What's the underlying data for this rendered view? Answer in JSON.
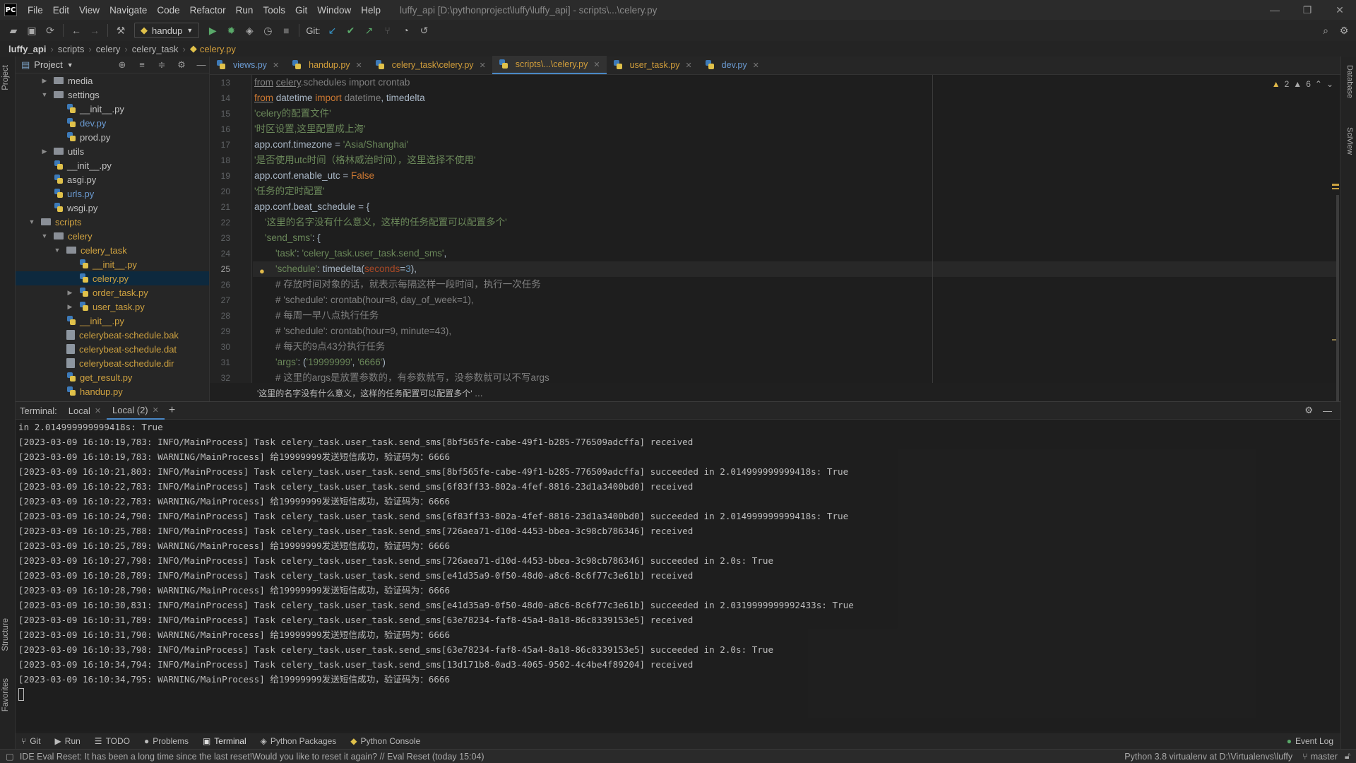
{
  "menubar": {
    "logo": "PC",
    "items": [
      "File",
      "Edit",
      "View",
      "Navigate",
      "Code",
      "Refactor",
      "Run",
      "Tools",
      "Git",
      "Window",
      "Help"
    ],
    "window_title": "luffy_api [D:\\pythonproject\\luffy\\luffy_api] - scripts\\...\\celery.py"
  },
  "toolbar": {
    "run_config": "handup",
    "git_label": "Git:"
  },
  "breadcrumb": [
    "luffy_api",
    "scripts",
    "celery",
    "celery_task",
    "celery.py"
  ],
  "left_strip": {
    "project": "Project",
    "structure": "Structure",
    "favorites": "Favorites"
  },
  "right_strip": {
    "database": "Database",
    "sciview": "SciView"
  },
  "project_panel": {
    "title": "Project",
    "tree": [
      {
        "label": "media",
        "type": "folder",
        "indent": 2,
        "arrow": "▶",
        "color": "plain"
      },
      {
        "label": "settings",
        "type": "folder",
        "indent": 2,
        "arrow": "▼",
        "color": "plain"
      },
      {
        "label": "__init__.py",
        "type": "py",
        "indent": 3,
        "color": "plain"
      },
      {
        "label": "dev.py",
        "type": "py",
        "indent": 3,
        "color": "blue"
      },
      {
        "label": "prod.py",
        "type": "py",
        "indent": 3,
        "color": "plain"
      },
      {
        "label": "utils",
        "type": "folder",
        "indent": 2,
        "arrow": "▶",
        "color": "plain"
      },
      {
        "label": "__init__.py",
        "type": "py",
        "indent": 2,
        "color": "plain"
      },
      {
        "label": "asgi.py",
        "type": "py",
        "indent": 2,
        "color": "plain"
      },
      {
        "label": "urls.py",
        "type": "py",
        "indent": 2,
        "color": "blue"
      },
      {
        "label": "wsgi.py",
        "type": "py",
        "indent": 2,
        "color": "plain"
      },
      {
        "label": "scripts",
        "type": "folder",
        "indent": 1,
        "arrow": "▼",
        "color": "mod"
      },
      {
        "label": "celery",
        "type": "folder",
        "indent": 2,
        "arrow": "▼",
        "color": "mod"
      },
      {
        "label": "celery_task",
        "type": "folder",
        "indent": 3,
        "arrow": "▼",
        "color": "mod"
      },
      {
        "label": "__init__.py",
        "type": "py",
        "indent": 4,
        "color": "mod"
      },
      {
        "label": "celery.py",
        "type": "py",
        "indent": 4,
        "color": "mod",
        "selected": true
      },
      {
        "label": "order_task.py",
        "type": "py",
        "indent": 4,
        "arrow": "▶",
        "color": "mod"
      },
      {
        "label": "user_task.py",
        "type": "py",
        "indent": 4,
        "arrow": "▶",
        "color": "mod"
      },
      {
        "label": "__init__.py",
        "type": "py",
        "indent": 3,
        "color": "mod"
      },
      {
        "label": "celerybeat-schedule.bak",
        "type": "file",
        "indent": 3,
        "color": "mod"
      },
      {
        "label": "celerybeat-schedule.dat",
        "type": "file",
        "indent": 3,
        "color": "mod"
      },
      {
        "label": "celerybeat-schedule.dir",
        "type": "file",
        "indent": 3,
        "color": "mod"
      },
      {
        "label": "get_result.py",
        "type": "py",
        "indent": 3,
        "color": "mod"
      },
      {
        "label": "handup.py",
        "type": "py",
        "indent": 3,
        "color": "mod"
      }
    ]
  },
  "editor": {
    "tabs": [
      {
        "label": "views.py",
        "color": "blue",
        "active": false
      },
      {
        "label": "handup.py",
        "color": "orange",
        "active": false
      },
      {
        "label": "celery_task\\celery.py",
        "color": "orange",
        "active": false
      },
      {
        "label": "scripts\\...\\celery.py",
        "color": "orange",
        "active": true
      },
      {
        "label": "user_task.py",
        "color": "orange",
        "active": false
      },
      {
        "label": "dev.py",
        "color": "blue",
        "active": false
      }
    ],
    "line_numbers": [
      "13",
      "14",
      "15",
      "16",
      "17",
      "18",
      "19",
      "20",
      "21",
      "22",
      "23",
      "24",
      "25",
      "26",
      "27",
      "28",
      "29",
      "30",
      "31",
      "32"
    ],
    "current_line": "25",
    "warnings": "2",
    "weak_warnings": "6",
    "bottom_breadcrumb": "'这里的名字没有什么意义，这样的任务配置可以配置多个'  …"
  },
  "terminal": {
    "label": "Terminal:",
    "tabs": [
      "Local",
      "Local (2)"
    ],
    "lines": [
      "in 2.014999999999418s: True",
      "[2023-03-09 16:10:19,783: INFO/MainProcess] Task celery_task.user_task.send_sms[8bf565fe-cabe-49f1-b285-776509adcffa] received",
      "[2023-03-09 16:10:19,783: WARNING/MainProcess] 给19999999发送短信成功，验证码为：6666",
      "[2023-03-09 16:10:21,803: INFO/MainProcess] Task celery_task.user_task.send_sms[8bf565fe-cabe-49f1-b285-776509adcffa] succeeded in 2.014999999999418s: True",
      "[2023-03-09 16:10:22,783: INFO/MainProcess] Task celery_task.user_task.send_sms[6f83ff33-802a-4fef-8816-23d1a3400bd0] received",
      "[2023-03-09 16:10:22,783: WARNING/MainProcess] 给19999999发送短信成功，验证码为：6666",
      "[2023-03-09 16:10:24,790: INFO/MainProcess] Task celery_task.user_task.send_sms[6f83ff33-802a-4fef-8816-23d1a3400bd0] succeeded in 2.014999999999418s: True",
      "[2023-03-09 16:10:25,788: INFO/MainProcess] Task celery_task.user_task.send_sms[726aea71-d10d-4453-bbea-3c98cb786346] received",
      "[2023-03-09 16:10:25,789: WARNING/MainProcess] 给19999999发送短信成功，验证码为：6666",
      "[2023-03-09 16:10:27,798: INFO/MainProcess] Task celery_task.user_task.send_sms[726aea71-d10d-4453-bbea-3c98cb786346] succeeded in 2.0s: True",
      "[2023-03-09 16:10:28,789: INFO/MainProcess] Task celery_task.user_task.send_sms[e41d35a9-0f50-48d0-a8c6-8c6f77c3e61b] received",
      "[2023-03-09 16:10:28,790: WARNING/MainProcess] 给19999999发送短信成功，验证码为：6666",
      "[2023-03-09 16:10:30,831: INFO/MainProcess] Task celery_task.user_task.send_sms[e41d35a9-0f50-48d0-a8c6-8c6f77c3e61b] succeeded in 2.0319999999992433s: True",
      "[2023-03-09 16:10:31,789: INFO/MainProcess] Task celery_task.user_task.send_sms[63e78234-faf8-45a4-8a18-86c8339153e5] received",
      "[2023-03-09 16:10:31,790: WARNING/MainProcess] 给19999999发送短信成功，验证码为：6666",
      "[2023-03-09 16:10:33,798: INFO/MainProcess] Task celery_task.user_task.send_sms[63e78234-faf8-45a4-8a18-86c8339153e5] succeeded in 2.0s: True",
      "[2023-03-09 16:10:34,794: INFO/MainProcess] Task celery_task.user_task.send_sms[13d171b8-0ad3-4065-9502-4c4be4f89204] received",
      "[2023-03-09 16:10:34,795: WARNING/MainProcess] 给19999999发送短信成功，验证码为：6666"
    ]
  },
  "bottom_tools": {
    "git": "Git",
    "run": "Run",
    "todo": "TODO",
    "problems": "Problems",
    "terminal": "Terminal",
    "python_packages": "Python Packages",
    "python_console": "Python Console",
    "event_log": "Event Log"
  },
  "statusbar": {
    "message": "IDE Eval Reset: It has been a long time since the last reset!Would you like to reset it again? // Eval Reset (today 15:04)",
    "interpreter": "Python 3.8 virtualenv at D:\\Virtualenvs\\luffy",
    "branch": "master"
  }
}
